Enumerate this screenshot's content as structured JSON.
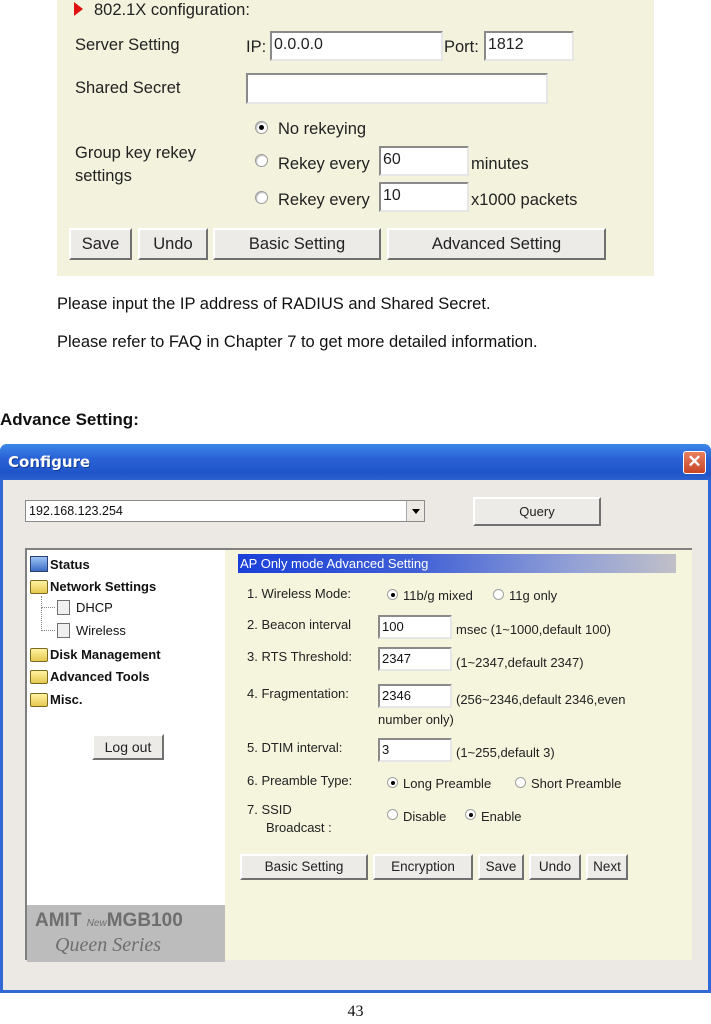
{
  "dot1x_panel": {
    "section_title": "802.1X configuration:",
    "server_setting_label": "Server Setting",
    "ip_label": "IP:",
    "ip_value": "0.0.0.0",
    "port_label": "Port:",
    "port_value": "1812",
    "shared_secret_label": "Shared Secret",
    "shared_secret_value": "",
    "group_key_label_line1": "Group key rekey",
    "group_key_label_line2": "settings",
    "rekey_options": [
      {
        "label": "No rekeying",
        "selected": true
      },
      {
        "label": "Rekey every",
        "value": "60",
        "unit": "minutes",
        "selected": false
      },
      {
        "label": "Rekey every",
        "value": "10",
        "unit": "x1000 packets",
        "selected": false
      }
    ],
    "buttons": {
      "save": "Save",
      "undo": "Undo",
      "basic": "Basic Setting",
      "advanced": "Advanced Setting"
    }
  },
  "doc": {
    "para1": "Please input the IP address of RADIUS and Shared Secret.",
    "para2": "Please refer to FAQ in Chapter 7 to get more detailed information.",
    "heading": "Advance Setting:",
    "page_number": "43"
  },
  "configure_window": {
    "title": "Configure",
    "close_glyph": "✕",
    "device_select_value": "192.168.123.254",
    "query_button": "Query",
    "tree": {
      "status": "Status",
      "network_settings": "Network Settings",
      "dhcp": "DHCP",
      "wireless": "Wireless",
      "disk_management": "Disk Management",
      "advanced_tools": "Advanced Tools",
      "misc": "Misc."
    },
    "logout_button": "Log out",
    "logo": {
      "brand": "AMIT",
      "new": "New",
      "model": "MGB100",
      "series": "Queen Series"
    },
    "content": {
      "banner": "AP Only mode Advanced Setting",
      "wireless_mode_label": "1.  Wireless Mode:",
      "wireless_mode_options": [
        {
          "label": "11b/g mixed",
          "selected": true
        },
        {
          "label": "11g only",
          "selected": false
        }
      ],
      "beacon_label": "2.  Beacon interval",
      "beacon_value": "100",
      "beacon_hint": "msec (1~1000,default 100)",
      "rts_label": "3.  RTS Threshold:",
      "rts_value": "2347",
      "rts_hint": "(1~2347,default 2347)",
      "frag_label": "4.  Fragmentation:",
      "frag_value": "2346",
      "frag_hint_line1": "(256~2346,default 2346,even",
      "frag_hint_line2": "number only)",
      "dtim_label": "5.  DTIM interval:",
      "dtim_value": "3",
      "dtim_hint": "(1~255,default 3)",
      "preamble_label": "6.  Preamble Type:",
      "preamble_options": [
        {
          "label": "Long Preamble",
          "selected": true
        },
        {
          "label": "Short Preamble",
          "selected": false
        }
      ],
      "ssid_label_line1": "7.  SSID",
      "ssid_label_line2": "Broadcast :",
      "ssid_options": [
        {
          "label": "Disable",
          "selected": false
        },
        {
          "label": "Enable",
          "selected": true
        }
      ],
      "buttons": {
        "basic": "Basic Setting",
        "encryption": "Encryption",
        "save": "Save",
        "undo": "Undo",
        "next": "Next"
      }
    }
  }
}
